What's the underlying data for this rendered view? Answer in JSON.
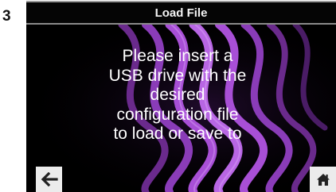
{
  "step": {
    "number": "3"
  },
  "screen": {
    "title": "Load File",
    "message_lines": [
      "Please insert a",
      "USB drive with the",
      "desired",
      "configuration file",
      "to load or save to"
    ]
  },
  "nav": {
    "back_icon": "left-arrow-icon",
    "home_icon": "home-icon"
  },
  "colors": {
    "screen_background": "#000000",
    "swirl_accent": "#a84fd6",
    "button_background": "#ececec"
  }
}
